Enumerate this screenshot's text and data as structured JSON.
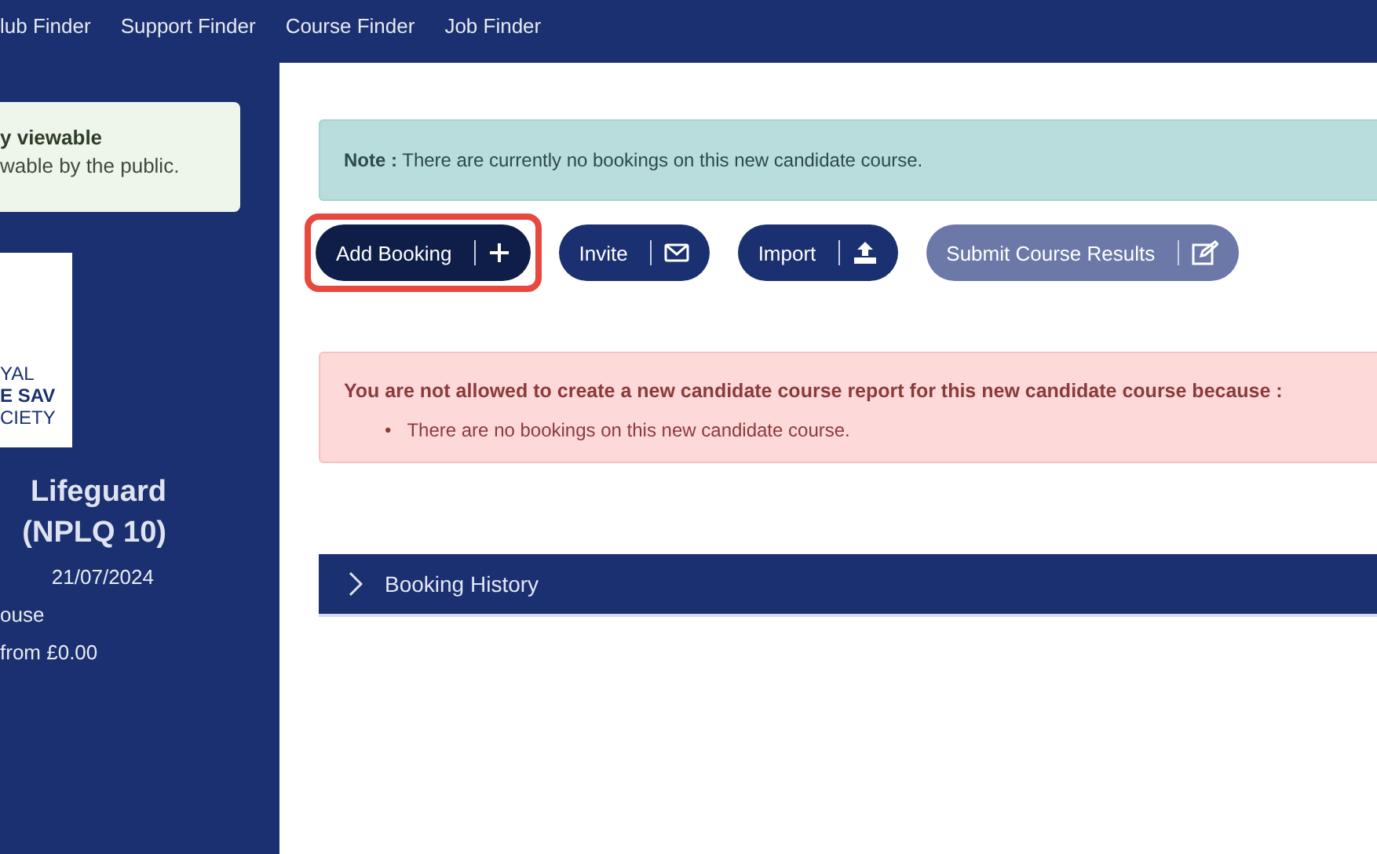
{
  "top_nav": {
    "links": [
      "lub Finder",
      "Support Finder",
      "Course Finder",
      "Job Finder"
    ]
  },
  "sidebar": {
    "notice": {
      "title": "y viewable",
      "text": "wable by the public."
    },
    "logo": {
      "lines": [
        "YAL",
        "E SAV",
        "CIETY"
      ]
    },
    "course_title": [
      "Lifeguard",
      "(NPLQ 10)"
    ],
    "date": "21/07/2024",
    "details": [
      "ouse",
      "from £0.00"
    ]
  },
  "note": {
    "label": "Note :",
    "text": "There are currently no bookings on this new candidate course."
  },
  "actions": [
    {
      "label": "Add Booking",
      "highlighted": true,
      "disabled": false
    },
    {
      "label": "Invite",
      "highlighted": false,
      "disabled": false
    },
    {
      "label": "Import",
      "highlighted": false,
      "disabled": false
    },
    {
      "label": "Submit Course Results",
      "highlighted": false,
      "disabled": true
    }
  ],
  "error": {
    "title": "You are not allowed to create a new candidate course report for this new candidate course because :",
    "items": [
      {
        "bullet": "•",
        "text": "There are no bookings on this new candidate course."
      }
    ]
  },
  "accordion": {
    "title": "Booking History",
    "expanded": false
  }
}
